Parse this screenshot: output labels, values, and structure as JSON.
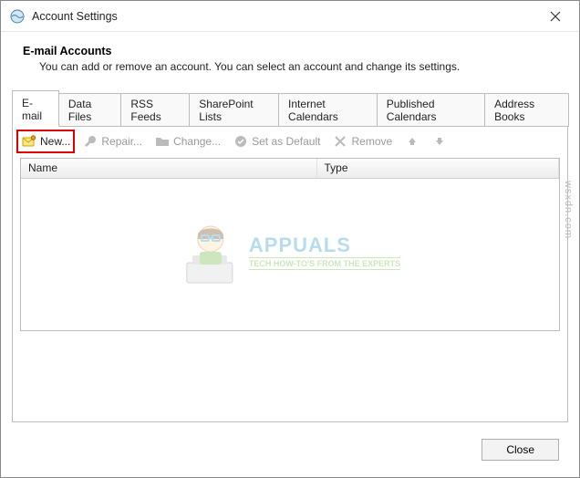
{
  "window": {
    "title": "Account Settings"
  },
  "header": {
    "title": "E-mail Accounts",
    "description": "You can add or remove an account. You can select an account and change its settings."
  },
  "tabs": [
    {
      "label": "E-mail",
      "active": true
    },
    {
      "label": "Data Files",
      "active": false
    },
    {
      "label": "RSS Feeds",
      "active": false
    },
    {
      "label": "SharePoint Lists",
      "active": false
    },
    {
      "label": "Internet Calendars",
      "active": false
    },
    {
      "label": "Published Calendars",
      "active": false
    },
    {
      "label": "Address Books",
      "active": false
    }
  ],
  "toolbar": {
    "new_label": "New...",
    "repair_label": "Repair...",
    "change_label": "Change...",
    "default_label": "Set as Default",
    "remove_label": "Remove"
  },
  "columns": {
    "name": "Name",
    "type": "Type"
  },
  "rows": [],
  "footer": {
    "close_label": "Close"
  },
  "watermark": {
    "brand": "APPUALS",
    "tagline": "TECH HOW-TO'S FROM THE EXPERTS",
    "domain": "wsxdn.com"
  }
}
